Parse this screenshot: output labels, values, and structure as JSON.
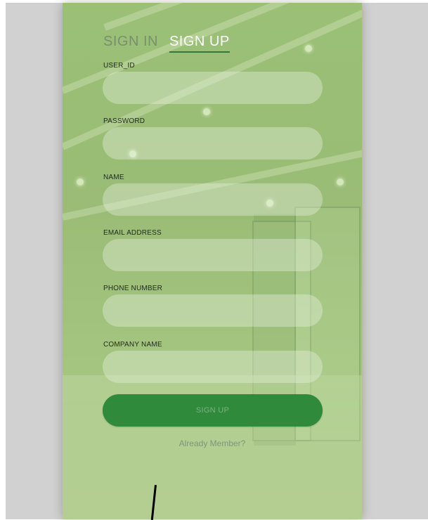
{
  "tabs": {
    "sign_in": "SIGN IN",
    "sign_up": "SIGN UP"
  },
  "form": {
    "user_id_label": "USER_ID",
    "password_label": "PASSWORD",
    "name_label": "NAME",
    "email_label": "EMAIL ADDRESS",
    "phone_label": "PHONE NUMBER",
    "company_label": "COMPANY NAME",
    "user_id_value": "",
    "password_value": "",
    "name_value": "",
    "email_value": "",
    "phone_value": "",
    "company_value": ""
  },
  "actions": {
    "signup_label": "SIGN UP",
    "already_member_label": "Already Member?"
  },
  "colors": {
    "primary_green": "#2f8a3c",
    "panel_tint": "#96be6e",
    "backdrop_gray": "#d1d1d1"
  }
}
